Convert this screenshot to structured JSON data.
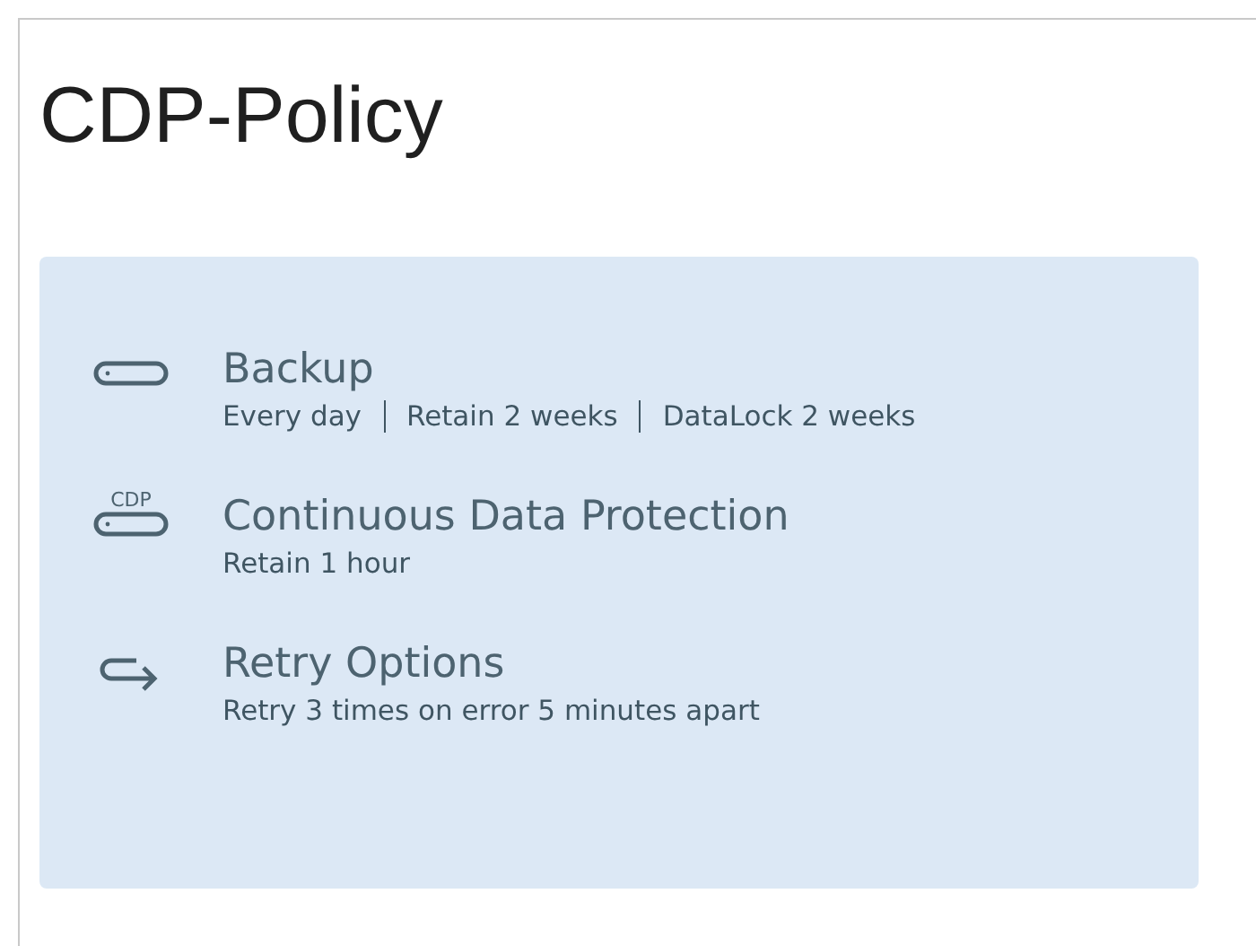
{
  "title": "CDP-Policy",
  "items": [
    {
      "kind": "backup",
      "title": "Backup",
      "details": [
        "Every day",
        "Retain 2 weeks",
        "DataLock 2 weeks"
      ]
    },
    {
      "kind": "cdp",
      "icon_text": "CDP",
      "title": "Continuous Data Protection",
      "details": [
        "Retain 1 hour"
      ]
    },
    {
      "kind": "retry",
      "title": "Retry Options",
      "details": [
        "Retry 3 times on error 5 minutes apart"
      ]
    }
  ]
}
